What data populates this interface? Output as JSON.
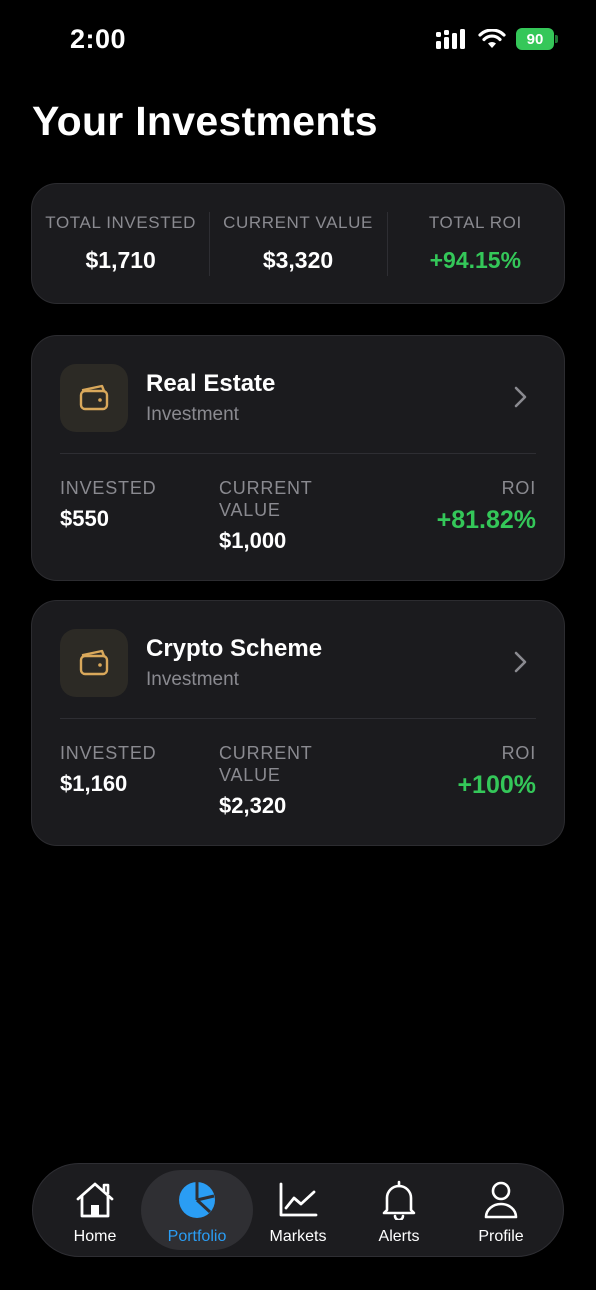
{
  "status_bar": {
    "time": "2:00",
    "battery": "90"
  },
  "page": {
    "title": "Your Investments"
  },
  "summary": {
    "total_invested_label": "TOTAL INVESTED",
    "total_invested_value": "$1,710",
    "current_value_label": "CURRENT VALUE",
    "current_value_value": "$3,320",
    "total_roi_label": "TOTAL ROI",
    "total_roi_value": "+94.15%"
  },
  "investments": [
    {
      "name": "Real Estate",
      "subtitle": "Investment",
      "invested_label": "INVESTED",
      "invested_value": "$550",
      "current_label_line1": "CURRENT",
      "current_label_line2": "VALUE",
      "current_value": "$1,000",
      "roi_label": "ROI",
      "roi_value": "+81.82%"
    },
    {
      "name": "Crypto Scheme",
      "subtitle": "Investment",
      "invested_label": "INVESTED",
      "invested_value": "$1,160",
      "current_label_line1": "CURRENT",
      "current_label_line2": "VALUE",
      "current_value": "$2,320",
      "roi_label": "ROI",
      "roi_value": "+100%"
    }
  ],
  "tab_bar": {
    "items": [
      {
        "label": "Home",
        "icon": "house-icon"
      },
      {
        "label": "Portfolio",
        "icon": "pie-chart-icon",
        "active": true
      },
      {
        "label": "Markets",
        "icon": "line-chart-icon"
      },
      {
        "label": "Alerts",
        "icon": "bell-icon"
      },
      {
        "label": "Profile",
        "icon": "person-icon"
      }
    ]
  },
  "colors": {
    "background": "#000000",
    "card": "#1b1b1e",
    "positive": "#34c759",
    "accent": "#2a9df4",
    "icon_gold": "#d9a85b",
    "muted_text": "#8a8a90"
  }
}
